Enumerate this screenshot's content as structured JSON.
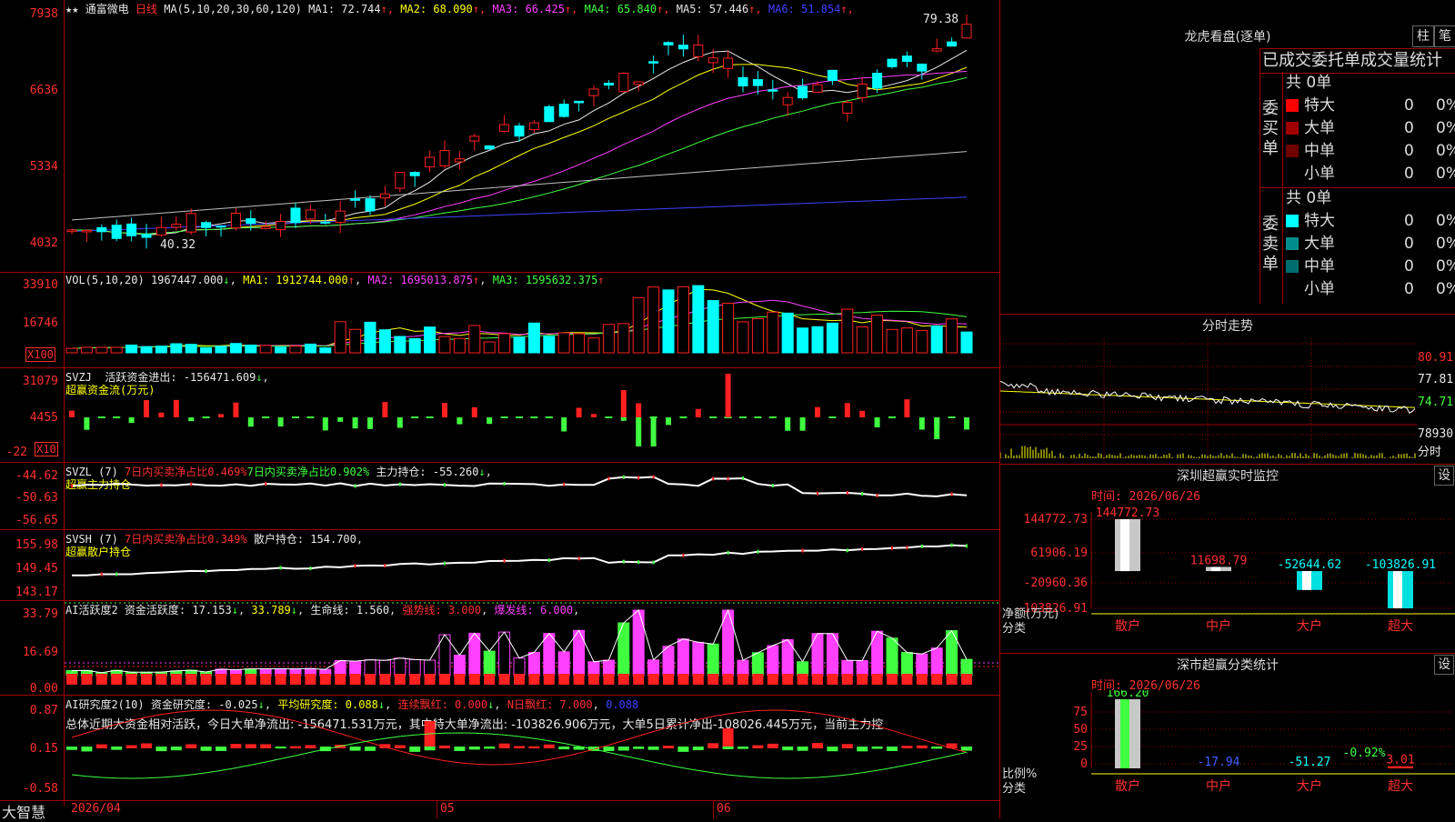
{
  "chart_title": "通富微电",
  "period": "日线",
  "main": {
    "ma_header": "MA(5,10,20,30,60,120)",
    "ma_values": [
      {
        "label": "MA1",
        "value": "72.744",
        "color": "#e8e8e8"
      },
      {
        "label": "MA2",
        "value": "68.090",
        "color": "#ffff00"
      },
      {
        "label": "MA3",
        "value": "66.425",
        "color": "#ff40ff"
      },
      {
        "label": "MA4",
        "value": "65.840",
        "color": "#40ff40"
      },
      {
        "label": "MA5",
        "value": "57.446",
        "color": "#e8e8e8"
      },
      {
        "label": "MA6",
        "value": "51.854",
        "color": "#4040ff"
      }
    ],
    "y_ticks": [
      "7938",
      "6636",
      "5334",
      "4032"
    ],
    "high_label": "79.38",
    "low_label": "40.32"
  },
  "vol": {
    "header": "VOL(5,10,20)",
    "value": "1967447.000",
    "ma": [
      {
        "label": "MA1",
        "value": "1912744.000"
      },
      {
        "label": "MA2",
        "value": "1695013.875"
      },
      {
        "label": "MA3",
        "value": "1595632.375"
      }
    ],
    "y_ticks": [
      "33910",
      "16746"
    ],
    "unit": "X100"
  },
  "svzj": {
    "header": "SVZJ",
    "label": "活跃资金进出:",
    "value": "-156471.609",
    "subtitle": "超赢资金流(万元)",
    "y_ticks": [
      "31079",
      "4455",
      "-22"
    ],
    "unit": "X10"
  },
  "svzl": {
    "header": "SVZL (7)",
    "t1": "7日内买卖净占比0.469%",
    "t2": "7日内买卖净占比0.902%",
    "t3": "主力持仓: -55.260",
    "subtitle": "超赢主力持仓",
    "y_ticks": [
      "-44.62",
      "-50.63",
      "-56.65"
    ]
  },
  "svsh": {
    "header": "SVSH (7)",
    "t1": "7日内买卖净占比0.349%",
    "t2": "散户持仓: 154.700",
    "subtitle": "超赢散户持仓",
    "y_ticks": [
      "155.98",
      "149.45",
      "143.17"
    ]
  },
  "ai1": {
    "header": "AI活跃度2",
    "t1": "资金活跃度: 17.153",
    "t2": "33.789",
    "t3": "生命线: 1.560",
    "t4": "强势线: 3.000",
    "t5": "爆发线: 6.000",
    "y_ticks": [
      "33.79",
      "16.69",
      "0.00"
    ]
  },
  "ai2": {
    "header": "AI研究度2(10)",
    "t1": "资金研究度: -0.025",
    "t2": "平均研究度: 0.088",
    "t3": "连续飘红: 0.000",
    "t4": "N日飘红: 7.000",
    "t5": "0.088",
    "summary": "总体近期大资金相对活跃，今日大单净流出: -156471.531万元，其中特大单净流出: -103826.906万元，大单5日累计净出-108026.445万元，当前主力控",
    "y_ticks": [
      "0.87",
      "0.15",
      "-0.58"
    ]
  },
  "xaxis": {
    "start": "2026/04",
    "m1": "05",
    "m2": "06"
  },
  "brand": "大智慧",
  "lhb": {
    "title": "龙虎看盘(逐单)",
    "btn1": "柱",
    "btn2": "笔",
    "tabs": "已成交委托单成交量统计",
    "buy_label": "委买单",
    "sell_label": "委卖单",
    "buy_total": "共 0单",
    "sell_total": "共 0单",
    "buy_rows": [
      {
        "name": "特大",
        "n": "0",
        "p": "0%",
        "color": "#ff0000"
      },
      {
        "name": "大单",
        "n": "0",
        "p": "0%",
        "color": "#a00000"
      },
      {
        "name": "中单",
        "n": "0",
        "p": "0%",
        "color": "#700000"
      },
      {
        "name": "小单",
        "n": "0",
        "p": "0%",
        "color": "#000000"
      }
    ],
    "sell_rows": [
      {
        "name": "特大",
        "n": "0",
        "p": "0%",
        "color": "#00ffff"
      },
      {
        "name": "大单",
        "n": "0",
        "p": "0%",
        "color": "#008c8c"
      },
      {
        "name": "中单",
        "n": "0",
        "p": "0%",
        "color": "#006e6e"
      },
      {
        "name": "小单",
        "n": "0",
        "p": "0%",
        "color": "#000000"
      }
    ]
  },
  "fenshi": {
    "title": "分时走势",
    "p1": "80.91",
    "p2": "77.81",
    "p3": "74.71",
    "vol": "78930",
    "unit": "分时"
  },
  "sz_monitor": {
    "title": "深圳超赢实时监控",
    "btn": "设",
    "time": "时间: 2026/06/26",
    "y_ticks": [
      "144772.73",
      "61906.19",
      "-20960.36",
      "-103826.91"
    ],
    "ylabel": "净额(万元)",
    "xlabel": "分类",
    "categories": [
      "散户",
      "中户",
      "大户",
      "超大"
    ],
    "values": [
      "144772.73",
      "11698.79",
      "-52644.62",
      "-103826.91"
    ]
  },
  "sz_class": {
    "title": "深市超赢分类统计",
    "btn": "设",
    "time": "时间: 2026/06/26",
    "y_ticks": [
      "75",
      "50",
      "25",
      "0"
    ],
    "ylabel": "比例%",
    "xlabel": "分类",
    "categories": [
      "散户",
      "中户",
      "大户",
      "超大"
    ],
    "values": [
      "166.20",
      "-17.94",
      "-51.27",
      "3.01"
    ],
    "extra": "-0.92%"
  }
}
